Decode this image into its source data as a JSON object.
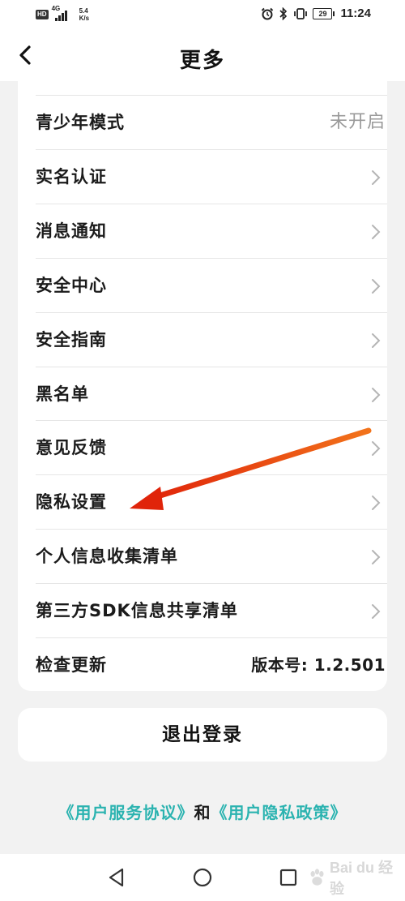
{
  "status_bar": {
    "hd": "HD",
    "network": "4G",
    "speed_value": "5.4",
    "speed_unit": "K/s",
    "battery": "29",
    "time": "11:24"
  },
  "header": {
    "title": "更多"
  },
  "menu": [
    {
      "label": "青少年模式",
      "value": "未开启"
    },
    {
      "label": "实名认证"
    },
    {
      "label": "消息通知"
    },
    {
      "label": "安全中心"
    },
    {
      "label": "安全指南"
    },
    {
      "label": "黑名单"
    },
    {
      "label": "意见反馈"
    },
    {
      "label": "隐私设置"
    },
    {
      "label": "个人信息收集清单"
    },
    {
      "label": "第三方SDK信息共享清单"
    },
    {
      "label": "检查更新",
      "value": "版本号: 1.2.501"
    }
  ],
  "logout_label": "退出登录",
  "footer": {
    "service_link": "《用户服务协议》",
    "and": "和",
    "privacy_link": "《用户隐私政策》"
  },
  "watermark": "Bai du 经验",
  "colors": {
    "link": "#2bb3b0",
    "arrow": "#e8460f",
    "background": "#f2f2f2"
  }
}
